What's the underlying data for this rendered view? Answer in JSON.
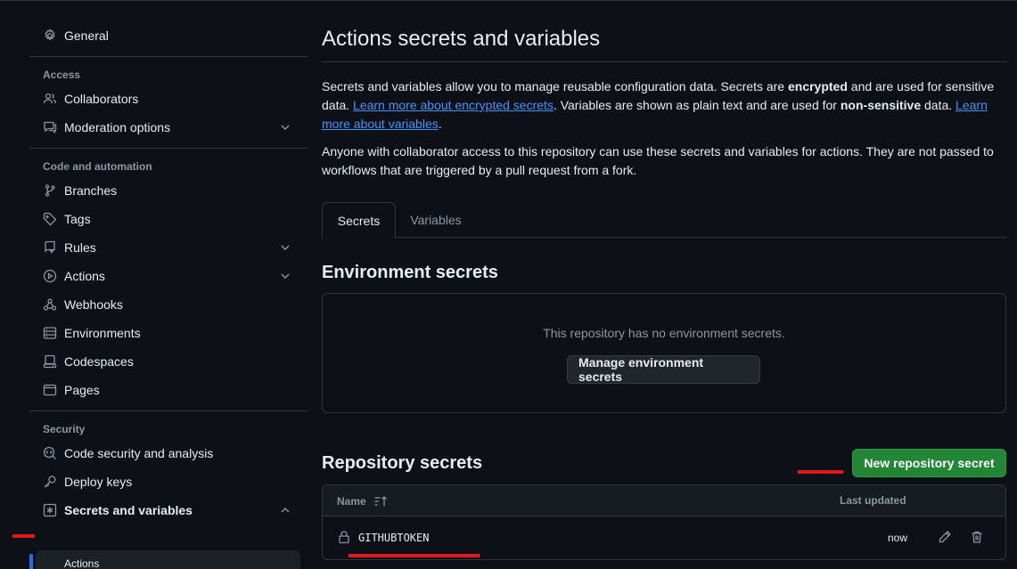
{
  "sidebar": {
    "general": "General",
    "sections": {
      "access": "Access",
      "code_automation": "Code and automation",
      "security": "Security"
    },
    "items": {
      "collaborators": "Collaborators",
      "moderation": "Moderation options",
      "branches": "Branches",
      "tags": "Tags",
      "rules": "Rules",
      "actions": "Actions",
      "webhooks": "Webhooks",
      "environments": "Environments",
      "codespaces": "Codespaces",
      "pages": "Pages",
      "code_security": "Code security and analysis",
      "deploy_keys": "Deploy keys",
      "secrets_variables": "Secrets and variables",
      "sub_actions": "Actions"
    }
  },
  "main": {
    "title": "Actions secrets and variables",
    "intro": {
      "p1_a": "Secrets and variables allow you to manage reusable configuration data. Secrets are ",
      "p1_b": "encrypted",
      "p1_c": " and are used for sensitive data. ",
      "p1_link1": "Learn more about encrypted secrets",
      "p1_d": ". Variables are shown as plain text and are used for ",
      "p1_e": "non-sensitive",
      "p1_f": " data. ",
      "p1_link2": "Learn more about variables",
      "p1_g": ".",
      "p2": "Anyone with collaborator access to this repository can use these secrets and variables for actions. They are not passed to workflows that are triggered by a pull request from a fork."
    },
    "tabs": [
      "Secrets",
      "Variables"
    ],
    "env": {
      "heading": "Environment secrets",
      "empty": "This repository has no environment secrets.",
      "button": "Manage environment secrets"
    },
    "repo": {
      "heading": "Repository secrets",
      "new_button": "New repository secret",
      "col_name": "Name",
      "col_updated": "Last updated",
      "rows": [
        {
          "name": "GITHUBTOKEN",
          "updated": "now"
        }
      ]
    }
  },
  "colors": {
    "background": "#0d1117",
    "accent_link": "#4493f8",
    "primary_button": "#238636",
    "annotation": "#e0191f"
  }
}
